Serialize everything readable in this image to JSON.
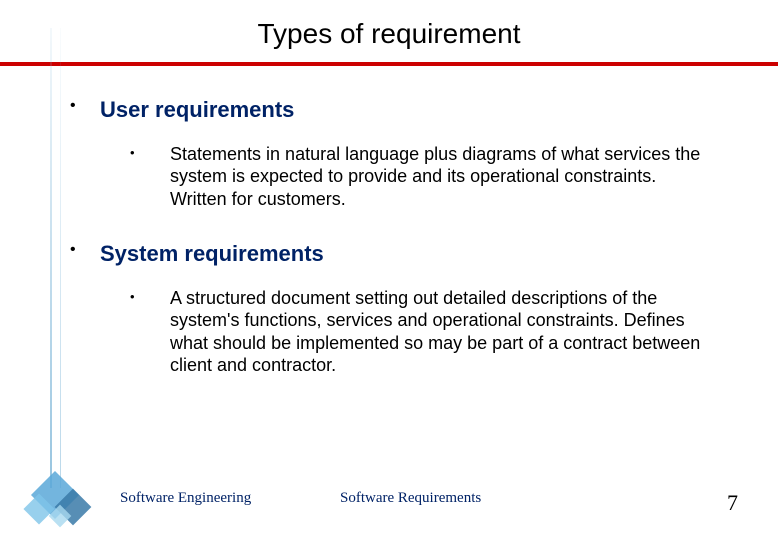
{
  "title": "Types of requirement",
  "items": [
    {
      "heading": "User requirements",
      "sub": "Statements in natural language plus diagrams of what services the system is expected to provide and its operational constraints. Written for customers."
    },
    {
      "heading": "System requirements",
      "sub": "A structured document setting out detailed descriptions of the system's functions, services and operational constraints. Defines what should be implemented so may be part of a contract between client and contractor."
    }
  ],
  "footer": {
    "left": "Software Engineering",
    "center": "Software Requirements",
    "page": "7"
  }
}
